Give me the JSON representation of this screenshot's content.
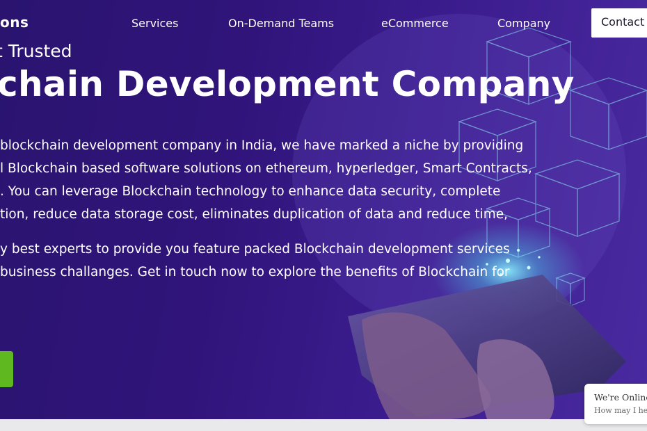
{
  "header": {
    "logo_text": "ons",
    "nav": [
      {
        "label": "Services"
      },
      {
        "label": "On-Demand Teams"
      },
      {
        "label": "eCommerce"
      },
      {
        "label": "Company"
      }
    ],
    "contact_label": "Contact U"
  },
  "hero": {
    "kicker": "t Trusted",
    "headline": "chain Development Company",
    "paragraph1": [
      "blockchain development company in India, we have marked a niche by providing",
      "l Blockchain based software solutions on ethereum, hyperledger, Smart Contracts,",
      ". You can leverage Blockchain technology to enhance data security, complete",
      "tion, reduce data storage cost, eliminates duplication of data and reduce time,"
    ],
    "paragraph2": [
      "y best experts to provide you feature packed Blockchain development services",
      " business challanges. Get in touch now to explore the benefits of Blockchain for"
    ]
  },
  "chat": {
    "title": "We're Online!",
    "subtitle": "How may I help you today?"
  },
  "colors": {
    "hero_background": "#30147a",
    "accent_cyan": "#6fe6f5",
    "cta_green": "#5fb81f"
  }
}
